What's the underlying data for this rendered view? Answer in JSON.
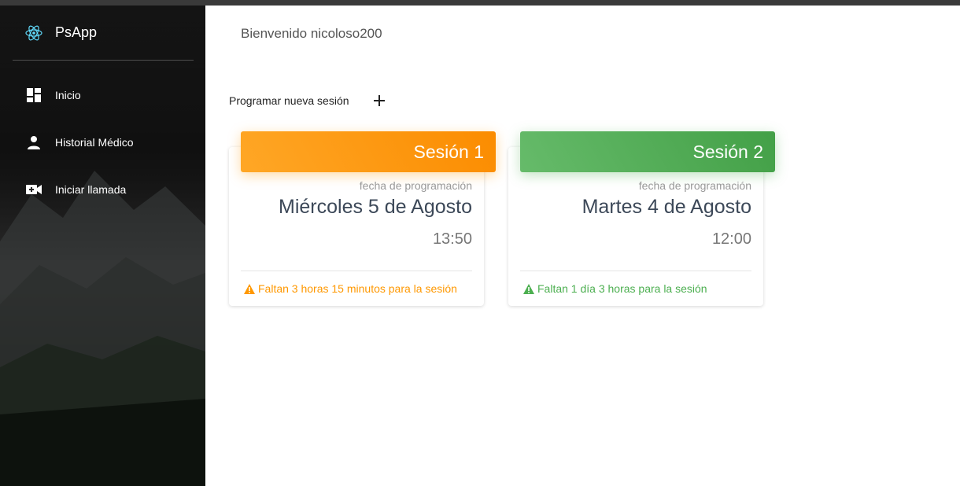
{
  "app": {
    "name": "PsApp"
  },
  "sidebar": {
    "items": [
      {
        "label": "Inicio",
        "icon": "dashboard-icon"
      },
      {
        "label": "Historial Médico",
        "icon": "person-icon"
      },
      {
        "label": "Iniciar llamada",
        "icon": "video-call-icon"
      }
    ]
  },
  "main": {
    "welcome": "Bienvenido nicoloso200",
    "schedule_label": "Programar nueva sesión",
    "sessions": [
      {
        "title": "Sesión 1",
        "category": "fecha de programación",
        "date": "Miércoles 5 de Agosto",
        "time": "13:50",
        "footer": "Faltan 3 horas 15 minutos para la sesión",
        "color": "#ff9800"
      },
      {
        "title": "Sesión 2",
        "category": "fecha de programación",
        "date": "Martes 4 de Agosto",
        "time": "12:00",
        "footer": "Faltan 1 día 3 horas para la sesión",
        "color": "#4caf50"
      }
    ]
  },
  "colors": {
    "accent_orange": "#ff9800",
    "accent_green": "#4caf50",
    "logo": "#61dafb"
  }
}
